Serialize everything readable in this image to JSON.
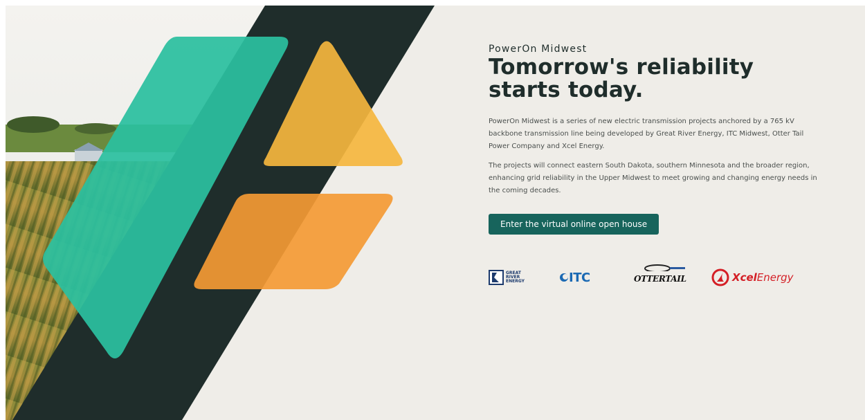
{
  "hero": {
    "eyebrow": "PowerOn Midwest",
    "headline": "Tomorrow's reliability starts today.",
    "paragraph_1": "PowerOn Midwest is a series of new electric transmission projects anchored by a 765 kV backbone transmission line being developed by Great River Energy, ITC Midwest, Otter Tail Power Company and Xcel Energy.",
    "paragraph_2": "The projects will connect eastern South Dakota, southern Minnesota and the broader region, enhancing grid reliability in the Upper Midwest to meet growing and changing energy needs in the coming decades.",
    "cta_label": "Enter the virtual online open house"
  },
  "partners": {
    "great_river_energy": "GREAT RIVER ENERGY",
    "itc": "ITC",
    "otter_tail": "OTTERTAIL",
    "xcel_bold": "Xcel",
    "xcel_rest": "Energy"
  },
  "colors": {
    "background": "#efede8",
    "dark_stripe": "#1f2d2b",
    "teal": "#2bbf9f",
    "gold": "#f5b63e",
    "orange": "#f49a34",
    "button": "#17645c",
    "xcel_red": "#d41f26",
    "itc_blue": "#1b69b3"
  }
}
